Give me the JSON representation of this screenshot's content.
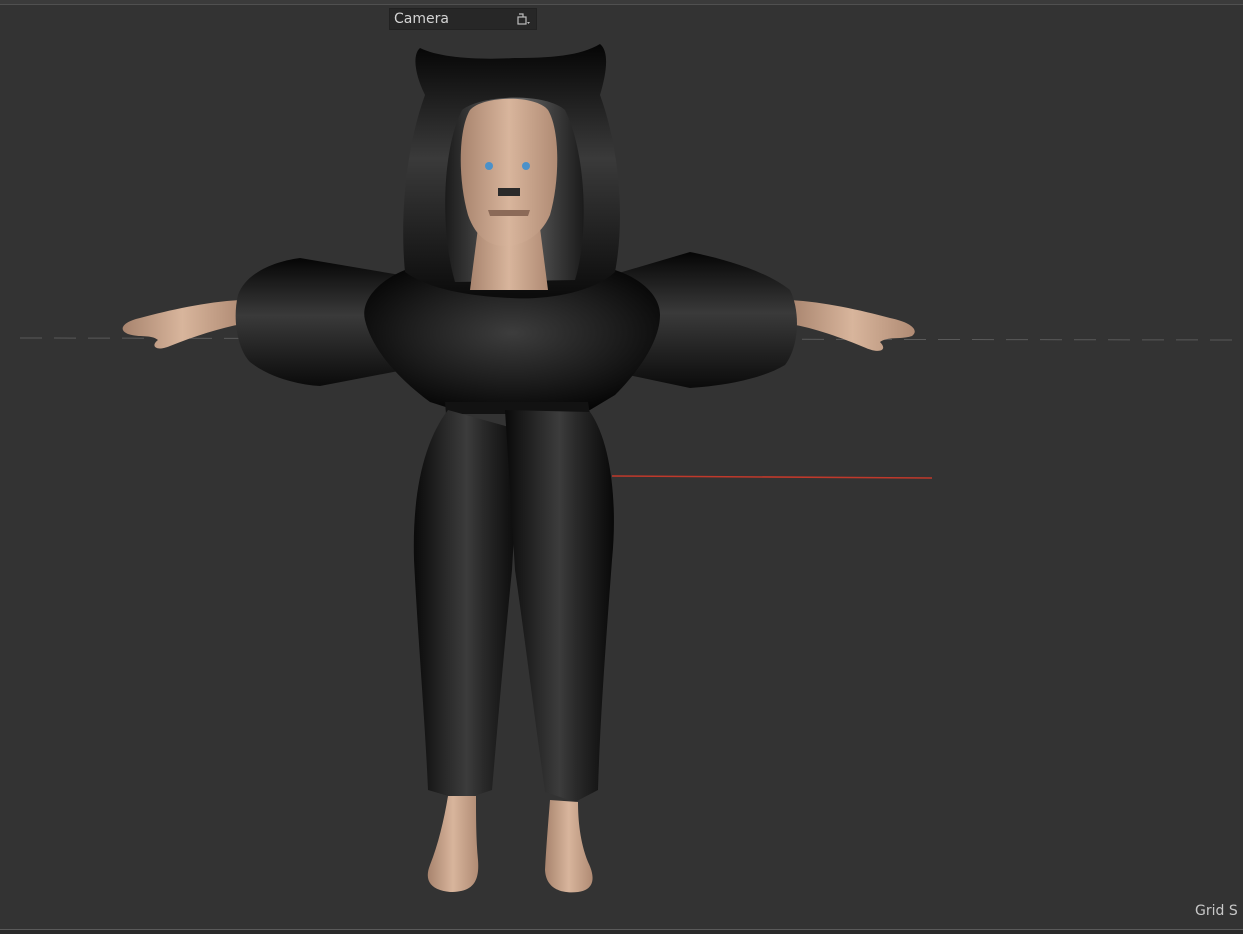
{
  "viewport": {
    "camera_label": "Camera",
    "grid_label": "Grid S",
    "background_color": "#333333",
    "axis_x_color": "#c0392b"
  },
  "icons": {
    "camera_lock": "lock-icon"
  }
}
